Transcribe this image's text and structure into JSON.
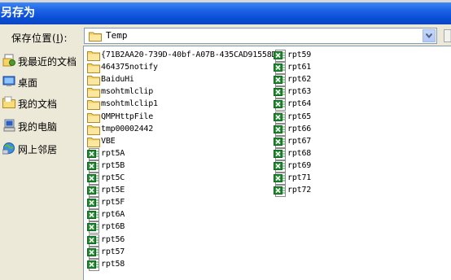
{
  "window": {
    "title": "另存为"
  },
  "toolbar": {
    "save_in_label": "保存位置",
    "save_in_accel": "I",
    "save_in_suffix": ":",
    "location_value": "Temp"
  },
  "places": [
    {
      "label": "我最近的文档",
      "icon": "recent-docs-icon"
    },
    {
      "label": "桌面",
      "icon": "desktop-icon"
    },
    {
      "label": "我的文档",
      "icon": "my-documents-icon"
    },
    {
      "label": "我的电脑",
      "icon": "my-computer-icon"
    },
    {
      "label": "网上邻居",
      "icon": "network-icon"
    }
  ],
  "files": {
    "col1": [
      {
        "name": "{71B2AA20-739D-40bf-A07B-435CAD91558D}",
        "type": "folder"
      },
      {
        "name": "464375notify",
        "type": "folder"
      },
      {
        "name": "BaiduHi",
        "type": "folder"
      },
      {
        "name": "msohtmlclip",
        "type": "folder"
      },
      {
        "name": "msohtmlclip1",
        "type": "folder"
      },
      {
        "name": "QMPHttpFile",
        "type": "folder"
      },
      {
        "name": "tmp00002442",
        "type": "folder"
      },
      {
        "name": "VBE",
        "type": "folder"
      },
      {
        "name": "rpt5A",
        "type": "excel"
      },
      {
        "name": "rpt5B",
        "type": "excel"
      },
      {
        "name": "rpt5C",
        "type": "excel"
      },
      {
        "name": "rpt5E",
        "type": "excel"
      },
      {
        "name": "rpt5F",
        "type": "excel"
      },
      {
        "name": "rpt6A",
        "type": "excel"
      },
      {
        "name": "rpt6B",
        "type": "excel"
      },
      {
        "name": "rpt56",
        "type": "excel"
      },
      {
        "name": "rpt57",
        "type": "excel"
      },
      {
        "name": "rpt58",
        "type": "excel"
      }
    ],
    "col2": [
      {
        "name": "rpt59",
        "type": "excel"
      },
      {
        "name": "rpt61",
        "type": "excel"
      },
      {
        "name": "rpt62",
        "type": "excel"
      },
      {
        "name": "rpt63",
        "type": "excel"
      },
      {
        "name": "rpt64",
        "type": "excel"
      },
      {
        "name": "rpt65",
        "type": "excel"
      },
      {
        "name": "rpt66",
        "type": "excel"
      },
      {
        "name": "rpt67",
        "type": "excel"
      },
      {
        "name": "rpt68",
        "type": "excel"
      },
      {
        "name": "rpt69",
        "type": "excel"
      },
      {
        "name": "rpt71",
        "type": "excel"
      },
      {
        "name": "rpt72",
        "type": "excel"
      }
    ]
  }
}
